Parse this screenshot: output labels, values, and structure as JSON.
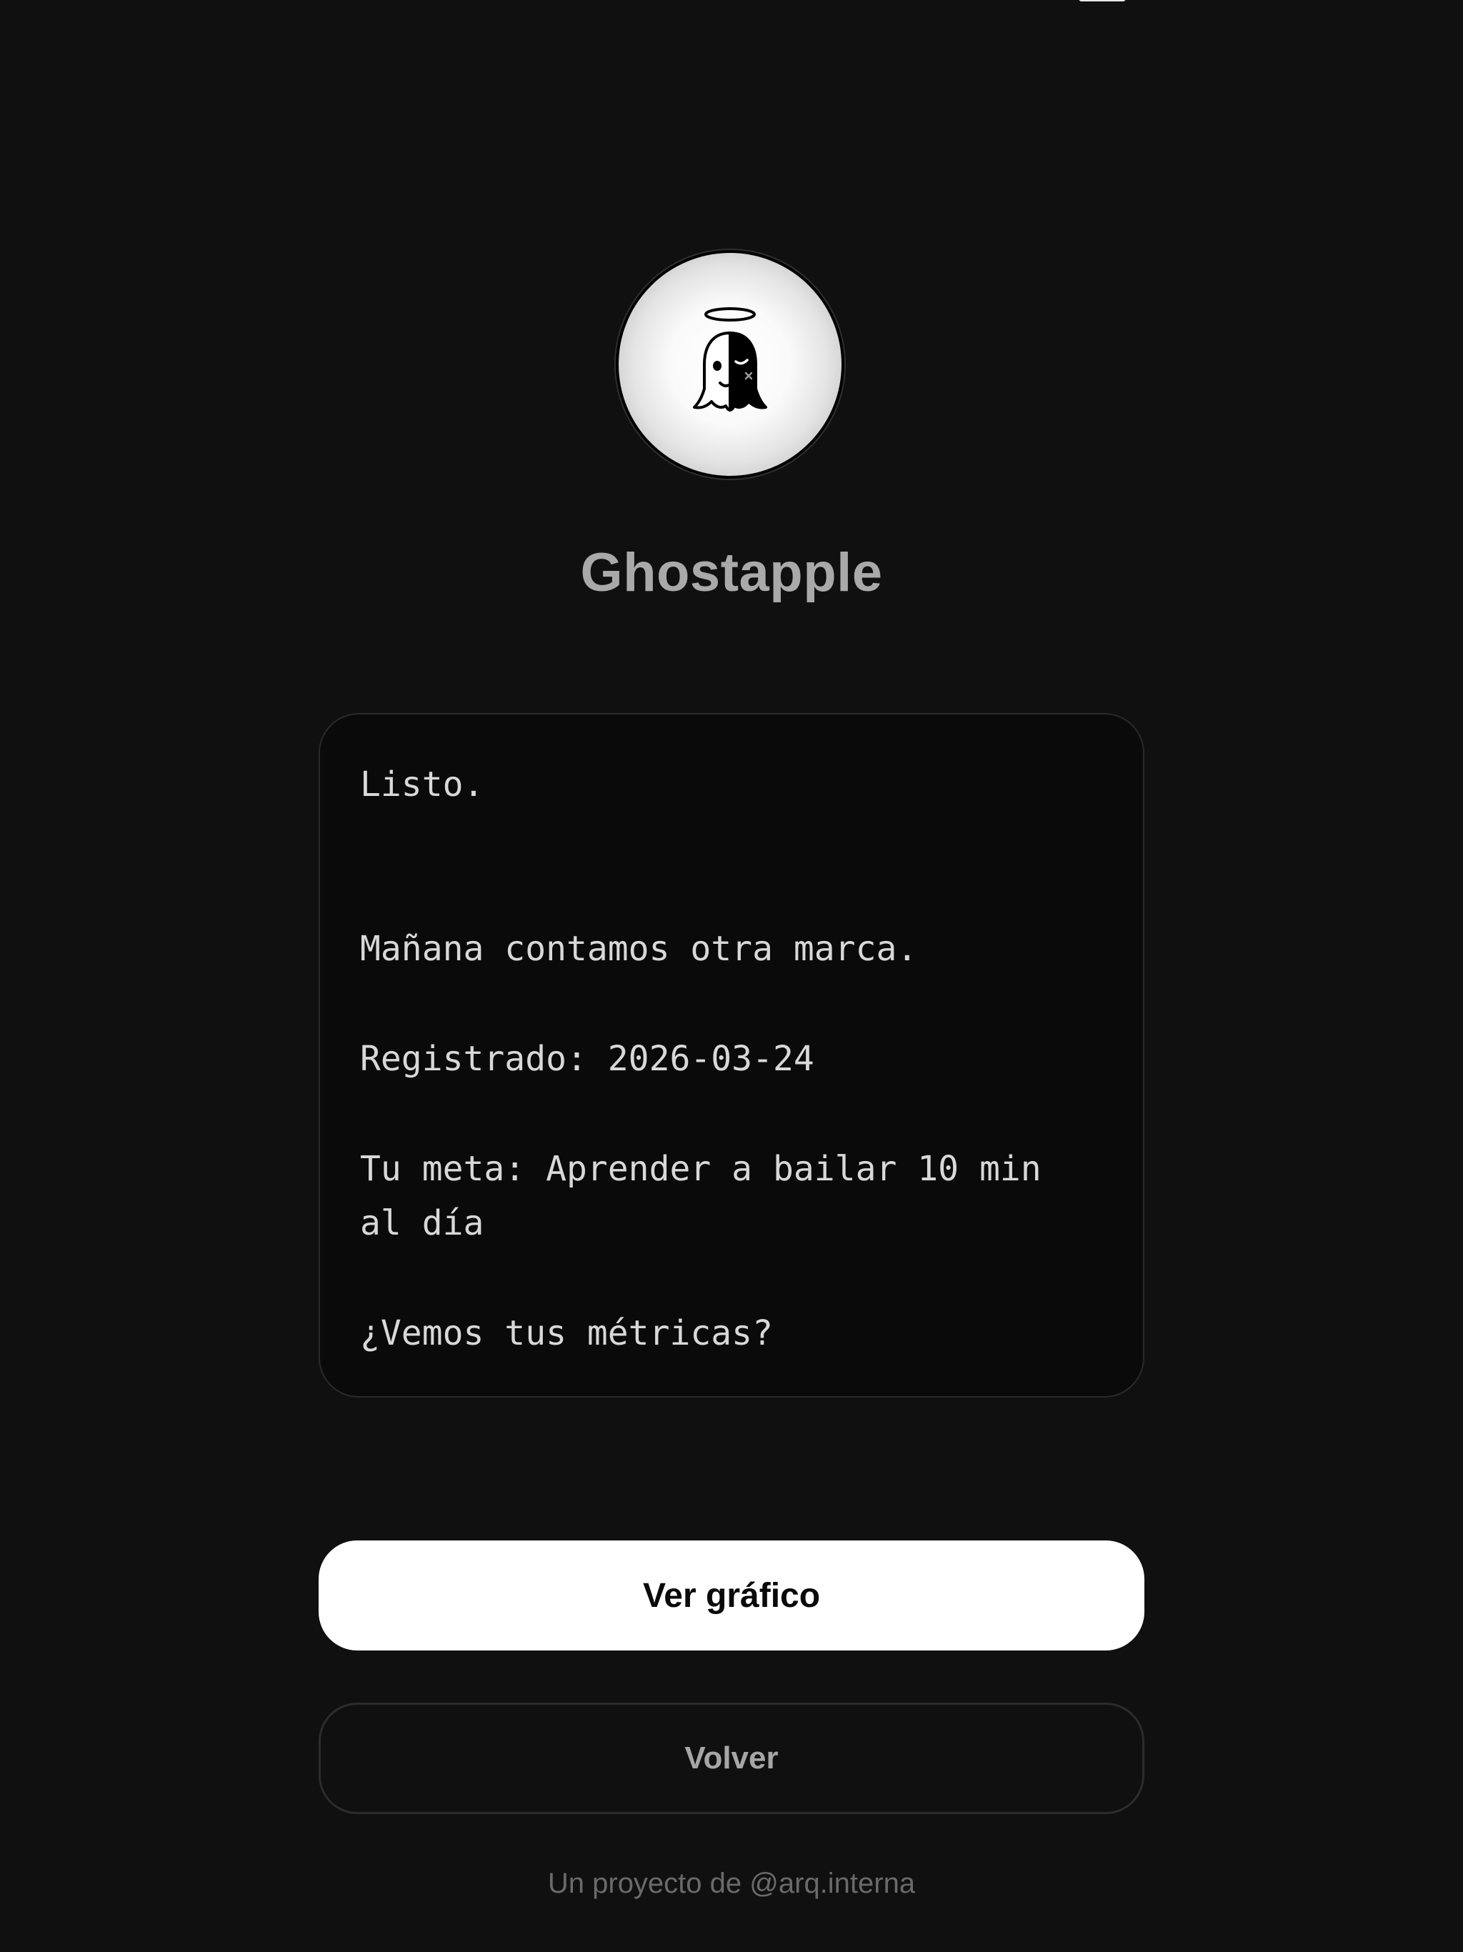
{
  "app": {
    "title": "Ghostapple",
    "avatar_icon": "ghost-halo-icon"
  },
  "message": {
    "line_1": "Listo.",
    "line_2": "Mañana contamos otra marca.",
    "line_3": "Registrado: 2026-03-24",
    "line_4": "Tu meta: Aprender a bailar 10 min\nal día",
    "line_5": "¿Vemos tus métricas?"
  },
  "actions": {
    "primary_label": "Ver gráfico",
    "secondary_label": "Volver"
  },
  "footer": {
    "prefix": "Un proyecto de ",
    "handle": "@arq.interna"
  },
  "colors": {
    "background": "#101010",
    "card_background": "#0a0a0a",
    "primary_button": "#ffffff",
    "title_text": "#a9a9a9"
  }
}
